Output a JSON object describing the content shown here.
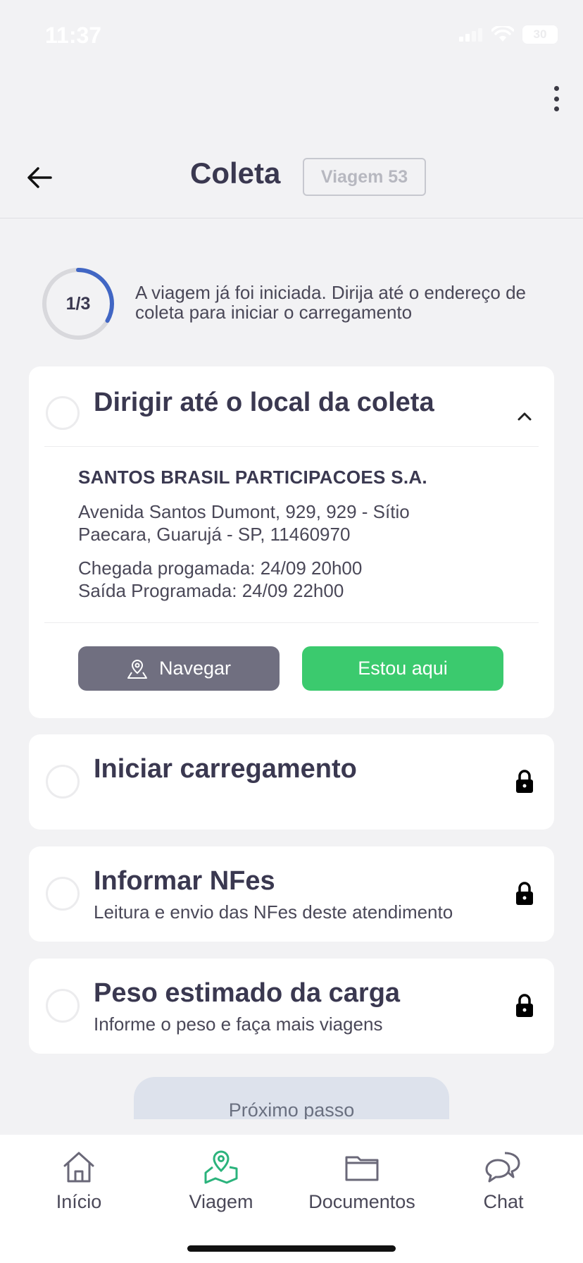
{
  "status_bar": {
    "time": "11:37",
    "battery": "30"
  },
  "header": {
    "title": "Coleta",
    "trip_badge": "Viagem 53"
  },
  "progress": {
    "label": "1/3",
    "fraction": 0.333,
    "text": "A viagem já foi iniciada. Dirija até o endereço de coleta para iniciar o carregamento"
  },
  "steps": [
    {
      "title": "Dirigir até o local da coleta",
      "expanded": true,
      "company": "SANTOS BRASIL PARTICIPACOES S.A.",
      "address_line1": "Avenida Santos Dumont, 929, 929 - Sítio",
      "address_line2": "Paecara, Guarujá - SP, 11460970",
      "arrival": "Chegada progamada: 24/09 20h00",
      "departure": "Saída Programada: 24/09 22h00",
      "navigate_label": "Navegar",
      "here_label": "Estou aqui"
    },
    {
      "title": "Iniciar carregamento",
      "subtitle": "",
      "locked": true
    },
    {
      "title": "Informar NFes",
      "subtitle": "Leitura e envio das NFes deste atendimento",
      "locked": true
    },
    {
      "title": "Peso estimado da carga",
      "subtitle": "Informe o peso e faça mais viagens",
      "locked": true
    }
  ],
  "next_button": {
    "label": "Próximo passo"
  },
  "bottom_nav": [
    {
      "label": "Início",
      "icon": "home-icon"
    },
    {
      "label": "Viagem",
      "icon": "map-pin-icon",
      "active": true
    },
    {
      "label": "Documentos",
      "icon": "folder-icon"
    },
    {
      "label": "Chat",
      "icon": "chat-icon"
    }
  ],
  "colors": {
    "accent_blue": "#4166c4",
    "primary_green": "#3bca6e",
    "nav_button": "#706f80",
    "active_nav": "#2bb37c",
    "text_dark": "#3a3850"
  }
}
